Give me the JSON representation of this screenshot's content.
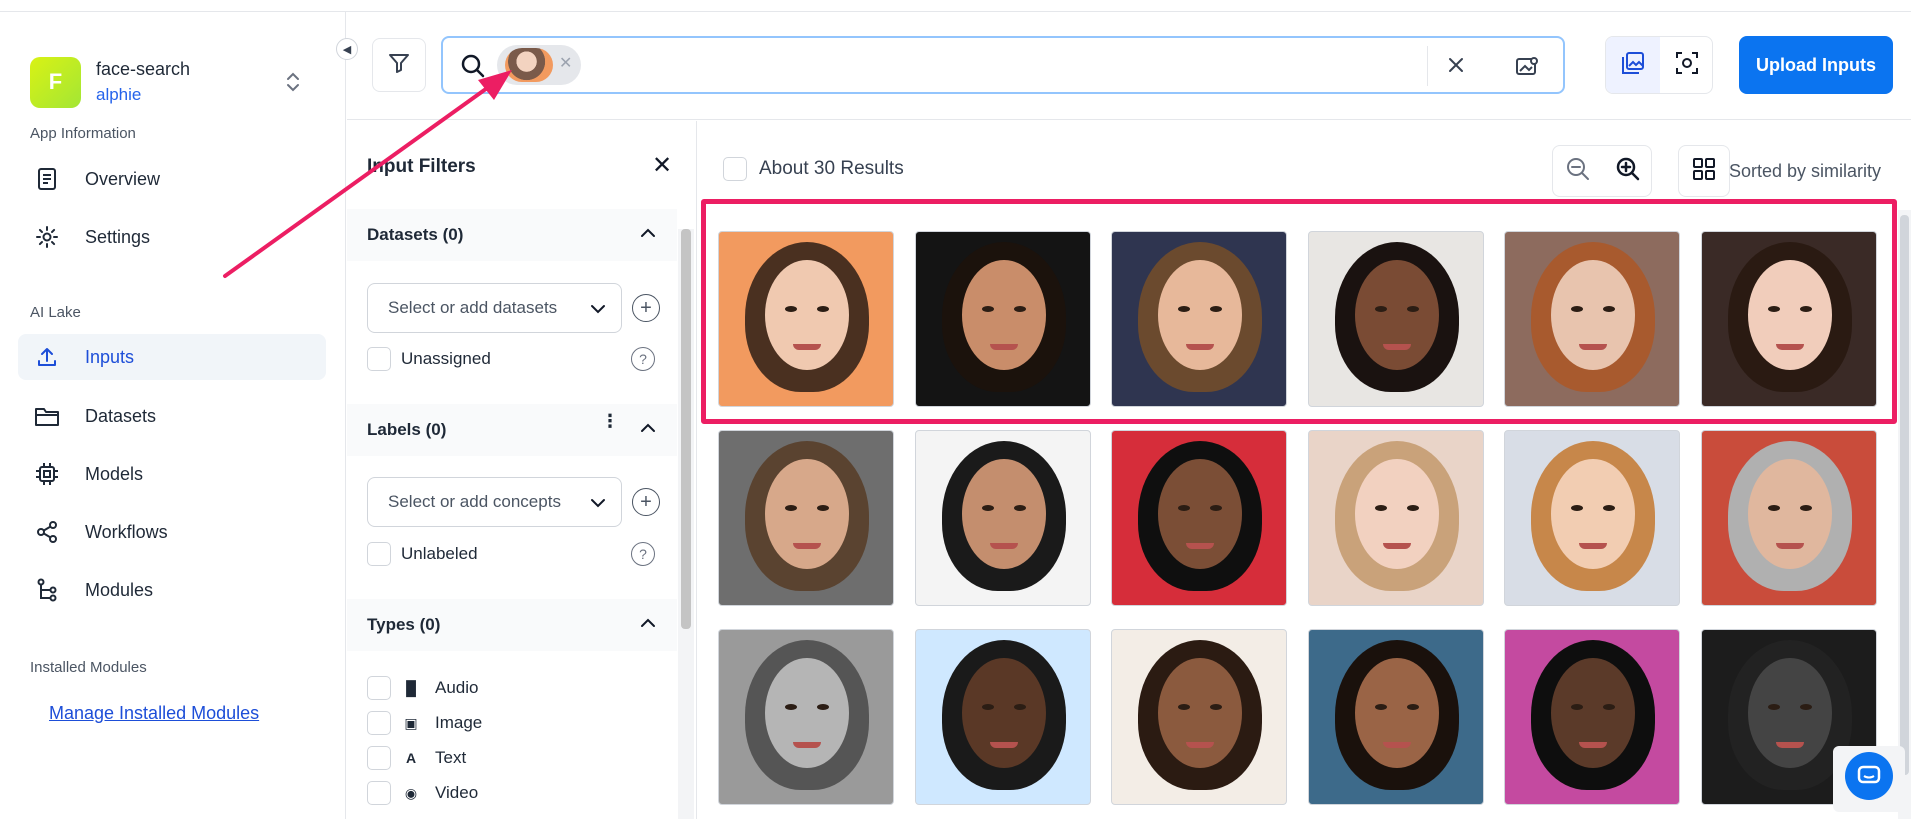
{
  "app": {
    "avatar_letter": "F",
    "name": "face-search",
    "user": "alphie"
  },
  "sidebar": {
    "section_app_info": "App Information",
    "section_ai_lake": "AI Lake",
    "section_installed": "Installed Modules",
    "items": [
      {
        "label": "Overview",
        "icon": "document-icon"
      },
      {
        "label": "Settings",
        "icon": "gear-icon"
      },
      {
        "label": "Inputs",
        "icon": "upload-icon",
        "active": true
      },
      {
        "label": "Datasets",
        "icon": "folder-icon"
      },
      {
        "label": "Models",
        "icon": "cpu-icon"
      },
      {
        "label": "Workflows",
        "icon": "share-icon"
      },
      {
        "label": "Modules",
        "icon": "flow-icon"
      }
    ],
    "manage_link": "Manage Installed Modules"
  },
  "header": {
    "upload_label": "Upload Inputs"
  },
  "filters": {
    "title": "Input Filters",
    "datasets": {
      "heading": "Datasets (0)",
      "placeholder": "Select or add datasets",
      "checkbox": "Unassigned"
    },
    "labels": {
      "heading": "Labels (0)",
      "placeholder": "Select or add concepts",
      "checkbox": "Unlabeled"
    },
    "types": {
      "heading": "Types (0)",
      "options": [
        "Audio",
        "Image",
        "Text",
        "Video"
      ]
    }
  },
  "results": {
    "count": "About 30 Results",
    "sort": "Sorted by similarity",
    "rows": 3,
    "cols": 6
  },
  "colors": {
    "accent": "#0b74f0",
    "highlight": "#ec1e63"
  }
}
